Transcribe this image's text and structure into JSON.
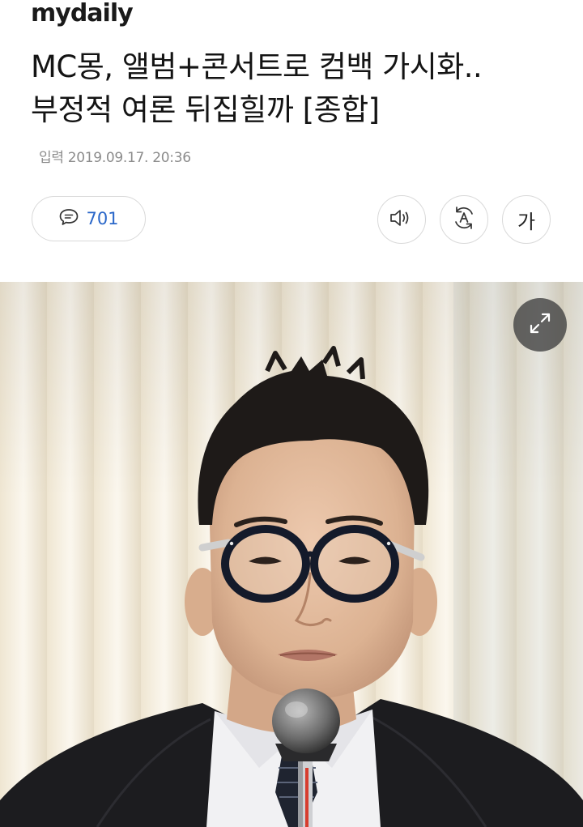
{
  "header": {
    "logo_text": "mydaily"
  },
  "article": {
    "headline_line1": "MC몽, 앨범+콘서트로 컴백 가시화..",
    "headline_line2": "부정적 여론 뒤집힐까 [종합]",
    "date_label": "입력",
    "date_value": "2019.09.17. 20:36"
  },
  "toolbar": {
    "comment_count": "701",
    "comment_icon": "speech-bubble-icon",
    "tts_icon": "speaker-icon",
    "translate_icon": "translate-icon",
    "font_size_label": "가"
  },
  "media": {
    "image_subject": "photo-man-glasses-microphone",
    "expand_icon": "expand-arrows-icon"
  },
  "colors": {
    "comment_count": "#2a67c9",
    "meta_text": "#8c8c8c",
    "button_border": "#d9d9d9",
    "expand_bg": "#464646"
  }
}
